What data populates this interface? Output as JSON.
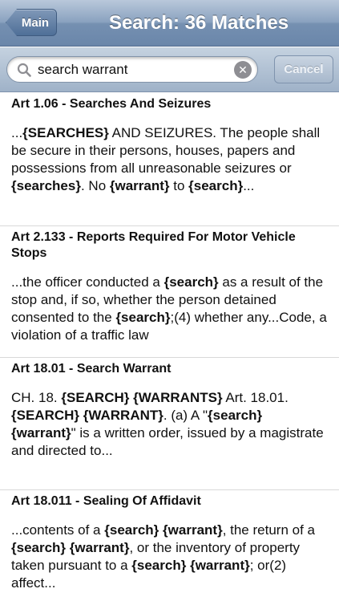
{
  "nav": {
    "back_label": "Main",
    "title": "Search: 36 Matches"
  },
  "search": {
    "value": "search warrant",
    "cancel_label": "Cancel"
  },
  "results": [
    {
      "title": "Art 1.06 - Searches And Seizures",
      "snippet": [
        {
          "t": "..."
        },
        {
          "t": "{SEARCHES}",
          "b": true
        },
        {
          "t": " AND SEIZURES. The people shall be secure in their persons, houses, papers and possessions from all unreasonable seizures or "
        },
        {
          "t": "{searches}",
          "b": true
        },
        {
          "t": ". No "
        },
        {
          "t": "{warrant}",
          "b": true
        },
        {
          "t": " to "
        },
        {
          "t": "{search}",
          "b": true
        },
        {
          "t": "..."
        }
      ]
    },
    {
      "title": "Art 2.133 - Reports Required For Motor Vehicle Stops",
      "snippet": [
        {
          "t": "...the officer conducted a "
        },
        {
          "t": "{search}",
          "b": true
        },
        {
          "t": " as a result of the stop and, if so, whether the person detained consented to the "
        },
        {
          "t": "{search}",
          "b": true
        },
        {
          "t": ";(4) whether any...Code, a violation of a traffic law"
        }
      ]
    },
    {
      "title": "Art 18.01 - Search Warrant",
      "snippet": [
        {
          "t": "CH. 18. "
        },
        {
          "t": "{SEARCH}",
          "b": true
        },
        {
          "t": " "
        },
        {
          "t": "{WARRANTS}",
          "b": true
        },
        {
          "t": " Art. 18.01. "
        },
        {
          "t": "{SEARCH}",
          "b": true
        },
        {
          "t": " "
        },
        {
          "t": "{WARRANT}",
          "b": true
        },
        {
          "t": ". (a) A \""
        },
        {
          "t": "{search}",
          "b": true
        },
        {
          "t": " "
        },
        {
          "t": "{warrant}",
          "b": true
        },
        {
          "t": "\" is a written order, issued by a magistrate and directed to..."
        }
      ]
    },
    {
      "title": "Art 18.011 - Sealing Of Affidavit",
      "snippet": [
        {
          "t": "...contents of a "
        },
        {
          "t": "{search}",
          "b": true
        },
        {
          "t": " "
        },
        {
          "t": "{warrant}",
          "b": true
        },
        {
          "t": ", the return of a "
        },
        {
          "t": "{search}",
          "b": true
        },
        {
          "t": " "
        },
        {
          "t": "{warrant}",
          "b": true
        },
        {
          "t": ", or the inventory of property taken pursuant to a "
        },
        {
          "t": "{search}",
          "b": true
        },
        {
          "t": " "
        },
        {
          "t": "{warrant}",
          "b": true
        },
        {
          "t": "; or(2) affect..."
        }
      ]
    }
  ]
}
